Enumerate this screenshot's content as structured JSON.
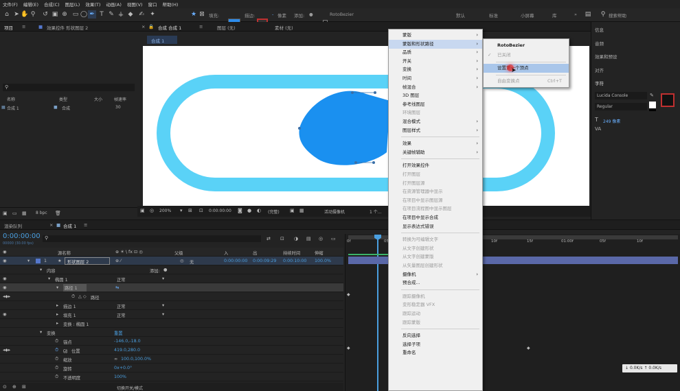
{
  "menubar": [
    "文件(F)",
    "编辑(E)",
    "合成(C)",
    "图层(L)",
    "效果(T)",
    "动画(A)",
    "视图(V)",
    "窗口",
    "帮助(H)"
  ],
  "toolbar": {
    "fill_label": "填充:",
    "stroke_label": "描边:",
    "stroke_unit": "像素",
    "add_label": "添加:",
    "roto_label": "RotoBezier",
    "workspace": [
      "默认",
      "标准",
      "小屏幕",
      "库"
    ],
    "search_placeholder": "搜索帮助"
  },
  "project": {
    "tabs": [
      "项目",
      "效果控件 形状图层 2"
    ],
    "columns": [
      "名称",
      "类型",
      "大小",
      "帧速率"
    ],
    "items": [
      {
        "name": "合成 1",
        "type": "合成",
        "fps": "30"
      }
    ],
    "bpc": "8 bpc"
  },
  "comp": {
    "tabs": [
      "合成 合成 1",
      "图层 (无)",
      "素材 (无)"
    ],
    "subtab": "合成 1",
    "zoom": "200%",
    "timecode": "0:00:00:00",
    "quality": "(完整)",
    "camera": "活动摄像机",
    "views": "1 个..."
  },
  "timeline": {
    "tabs": [
      "渲染队列",
      "合成 1"
    ],
    "timecode": "0:00:00:00",
    "fps_note": "00000 (30.00 fps)",
    "columns": [
      "源名称",
      "父级",
      "入",
      "出",
      "持续时间",
      "伸缩"
    ],
    "layer": {
      "num": "1",
      "name": "形状图层 2",
      "parent": "无",
      "in": "0:00:00:00",
      "out": "0:00:09:29",
      "duration": "0:00:10:00",
      "stretch": "100.0%"
    },
    "add_label": "添加:",
    "props": [
      {
        "label": "内容",
        "indent": 60
      },
      {
        "label": "椭圆 1",
        "value": "正常",
        "indent": 76
      },
      {
        "label": "路径 1",
        "indent": 90
      },
      {
        "label": "路径",
        "indent": 104,
        "icon": true
      },
      {
        "label": "描边 1",
        "value": "正常",
        "indent": 90
      },
      {
        "label": "填充 1",
        "value": "正常",
        "indent": 90
      },
      {
        "label": "变换 : 椭圆 1",
        "indent": 90
      },
      {
        "label": "变换",
        "value": "重置",
        "indent": 60
      },
      {
        "label": "锚点",
        "value": "-146.0,-18.0",
        "indent": 90
      },
      {
        "label": "位置",
        "value": "419.0,280.0",
        "indent": 90,
        "icon": true
      },
      {
        "label": "缩放",
        "value": "100.0,100.0%",
        "indent": 90
      },
      {
        "label": "旋转",
        "value": "0x+0.0°",
        "indent": 90
      },
      {
        "label": "不透明度",
        "value": "100%",
        "indent": 90
      }
    ],
    "toggle_label": "切换开关/模式",
    "ruler": [
      "0f",
      "05f",
      "10f",
      "15f",
      "20f",
      "01:00f",
      "05f",
      "10f"
    ],
    "speeds": [
      "0.0K/s",
      "0.0K/s"
    ]
  },
  "context_menu": {
    "items": [
      {
        "label": "蒙版",
        "sub": true
      },
      {
        "label": "蒙版和形状路径",
        "sub": true,
        "state": "open"
      },
      {
        "label": "品质",
        "sub": true
      },
      {
        "label": "开关",
        "sub": true
      },
      {
        "label": "变换",
        "sub": true
      },
      {
        "label": "时间",
        "sub": true
      },
      {
        "label": "帧混合",
        "sub": true
      },
      {
        "label": "3D 图层"
      },
      {
        "label": "参考线图层"
      },
      {
        "label": "环境图层",
        "disabled": true
      },
      {
        "label": "混合模式",
        "sub": true
      },
      {
        "label": "图层样式",
        "sub": true
      },
      {
        "label": "---"
      },
      {
        "label": "效果",
        "sub": true
      },
      {
        "label": "关键帧辅助",
        "sub": true
      },
      {
        "label": "---"
      },
      {
        "label": "打开效果控件"
      },
      {
        "label": "打开图层",
        "disabled": true
      },
      {
        "label": "打开图层源",
        "disabled": true
      },
      {
        "label": "在资源管理器中显示",
        "disabled": true
      },
      {
        "label": "在项目中显示图层源",
        "disabled": true
      },
      {
        "label": "在项目流程图中显示图层",
        "disabled": true
      },
      {
        "label": "在项目中显示合成"
      },
      {
        "label": "显示表达式错误"
      },
      {
        "label": "---"
      },
      {
        "label": "转换为可编辑文字",
        "disabled": true
      },
      {
        "label": "从文字创建形状",
        "disabled": true
      },
      {
        "label": "从文字创建蒙版",
        "disabled": true
      },
      {
        "label": "从矢量图层创建形状",
        "disabled": true
      },
      {
        "label": "摄像机",
        "sub": true
      },
      {
        "label": "预合成..."
      },
      {
        "label": "---"
      },
      {
        "label": "跟踪摄像机",
        "disabled": true
      },
      {
        "label": "变形稳定器 VFX",
        "disabled": true
      },
      {
        "label": "跟踪运动",
        "disabled": true
      },
      {
        "label": "跟踪蒙版",
        "disabled": true
      },
      {
        "label": "---"
      },
      {
        "label": "反向选择"
      },
      {
        "label": "选择子项"
      },
      {
        "label": "重命名"
      }
    ]
  },
  "submenu": {
    "items": [
      {
        "label": "RotoBezier",
        "bold": true
      },
      {
        "label": "已关闭",
        "disabled": true,
        "check": true
      },
      {
        "label": "---"
      },
      {
        "label": "设置第一个顶点",
        "state": "hover"
      },
      {
        "label": "---"
      },
      {
        "label": "自由变换点",
        "disabled": true,
        "shortcut": "Ctrl+T"
      }
    ]
  },
  "right_panel": {
    "items": [
      "信息",
      "音频",
      "效果和预设",
      "对齐",
      "字符"
    ],
    "font": "Lucida Console",
    "style": "Regular",
    "size": "249 像素"
  },
  "colors": {
    "accent": "#2d8ceb",
    "shape_fill": "#1a90f0",
    "stroke": "#5ad2f7"
  }
}
